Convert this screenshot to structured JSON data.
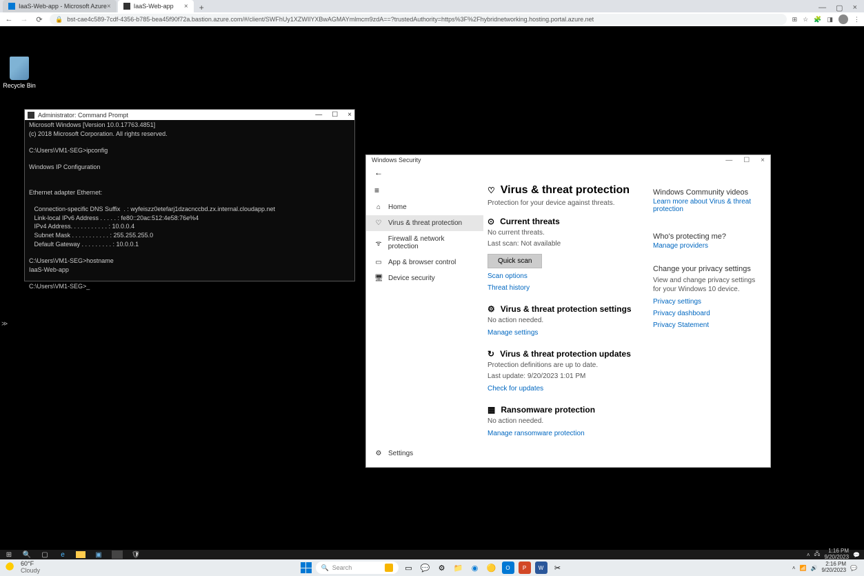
{
  "browser": {
    "tab1": "IaaS-Web-app - Microsoft Azure",
    "tab2": "IaaS-Web-app",
    "url": "bst-cae4c589-7cdf-4356-b785-bea45f90f72a.bastion.azure.com/#/client/SWFhUy1XZWIlYXBwAGMAYmlmcm9zdA==?trustedAuthority=https%3F%2Fhybridnetworking.hosting.portal.azure.net"
  },
  "desktop": {
    "recycle": "Recycle Bin"
  },
  "cmd": {
    "title": "Administrator: Command Prompt",
    "l1": "Microsoft Windows [Version 10.0.17763.4851]",
    "l2": "(c) 2018 Microsoft Corporation. All rights reserved.",
    "l3": "C:\\Users\\VM1-SEG>ipconfig",
    "l4": "Windows IP Configuration",
    "l5": "Ethernet adapter Ethernet:",
    "l6": "   Connection-specific DNS Suffix  . : wyfeiszz0etefarj1dzacnccbd.zx.internal.cloudapp.net",
    "l7": "   Link-local IPv6 Address . . . . . : fe80::20ac:512:4e58:76e%4",
    "l8": "   IPv4 Address. . . . . . . . . . . : 10.0.0.4",
    "l9": "   Subnet Mask . . . . . . . . . . . : 255.255.255.0",
    "l10": "   Default Gateway . . . . . . . . . : 10.0.0.1",
    "l11": "C:\\Users\\VM1-SEG>hostname",
    "l12": "IaaS-Web-app",
    "l13": "C:\\Users\\VM1-SEG>_"
  },
  "sec": {
    "title": "Windows Security",
    "nav": {
      "home": "Home",
      "virus": "Virus & threat protection",
      "firewall": "Firewall & network protection",
      "app": "App & browser control",
      "device": "Device security",
      "settings": "Settings"
    },
    "h1": "Virus & threat protection",
    "sub": "Protection for your device against threats.",
    "threats_h": "Current threats",
    "threats_none": "No current threats.",
    "threats_scan": "Last scan: Not available",
    "quick": "Quick scan",
    "scan_opts": "Scan options",
    "threat_hist": "Threat history",
    "settings_h": "Virus & threat protection settings",
    "settings_txt": "No action needed.",
    "settings_link": "Manage settings",
    "updates_h": "Virus & threat protection updates",
    "updates_txt1": "Protection definitions are up to date.",
    "updates_txt2": "Last update: 9/20/2023 1:01 PM",
    "updates_link": "Check for updates",
    "ransom_h": "Ransomware protection",
    "ransom_txt": "No action needed.",
    "ransom_link": "Manage ransomware protection",
    "side": {
      "vids_h": "Windows Community videos",
      "vids_link": "Learn more about Virus & threat protection",
      "who_h": "Who's protecting me?",
      "who_link": "Manage providers",
      "priv_h": "Change your privacy settings",
      "priv_txt": "View and change privacy settings for your Windows 10 device.",
      "priv_l1": "Privacy settings",
      "priv_l2": "Privacy dashboard",
      "priv_l3": "Privacy Statement"
    }
  },
  "vm_taskbar": {
    "time": "1:16 PM",
    "date": "9/20/2023"
  },
  "host_taskbar": {
    "temp": "60°F",
    "cond": "Cloudy",
    "search": "Search",
    "time": "2:16 PM",
    "date": "9/20/2023"
  }
}
